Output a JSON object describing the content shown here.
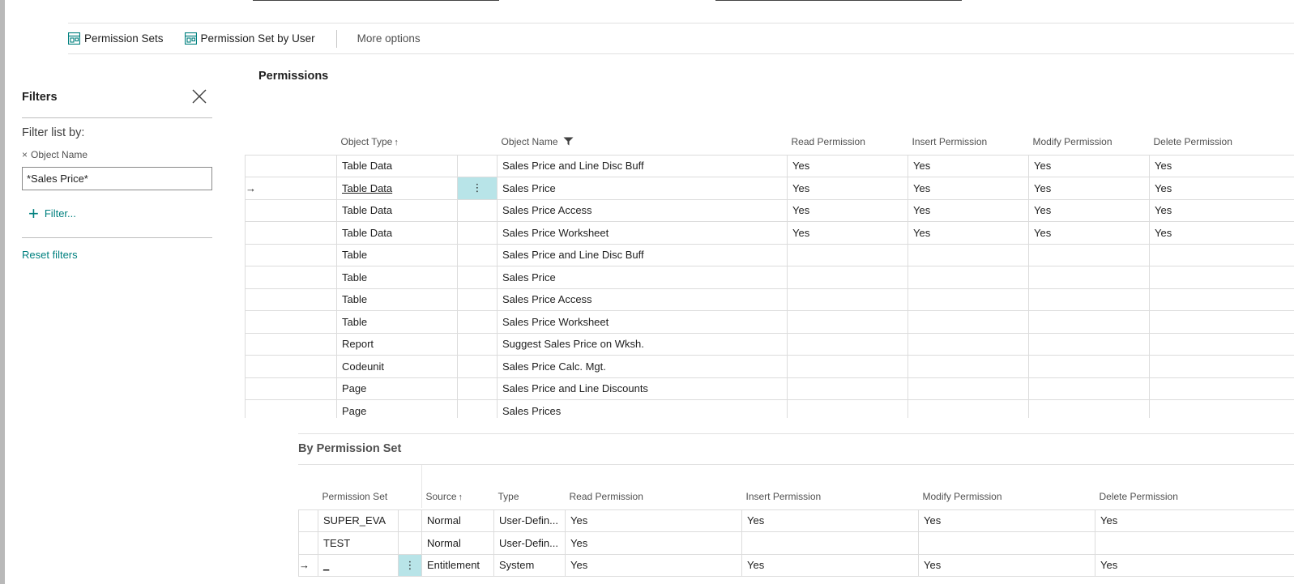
{
  "actions": {
    "permission_sets": "Permission Sets",
    "permission_set_by_user": "Permission Set by User",
    "more_options": "More options"
  },
  "filters": {
    "title": "Filters",
    "filter_list_by": "Filter list by:",
    "field_label": "Object Name",
    "field_value": "*Sales Price*",
    "add_filter": "Filter...",
    "reset": "Reset filters"
  },
  "permissions": {
    "title": "Permissions",
    "columns": {
      "object_type": "Object Type",
      "object_name": "Object Name",
      "read": "Read Permission",
      "insert": "Insert Permission",
      "modify": "Modify Permission",
      "delete": "Delete Permission"
    },
    "rows": [
      {
        "type": "Table Data",
        "name": "Sales Price and Line Disc Buff",
        "read": "Yes",
        "insert": "Yes",
        "modify": "Yes",
        "delete": "Yes"
      },
      {
        "type": "Table Data",
        "name": "Sales Price",
        "read": "Yes",
        "insert": "Yes",
        "modify": "Yes",
        "delete": "Yes"
      },
      {
        "type": "Table Data",
        "name": "Sales Price Access",
        "read": "Yes",
        "insert": "Yes",
        "modify": "Yes",
        "delete": "Yes"
      },
      {
        "type": "Table Data",
        "name": "Sales Price Worksheet",
        "read": "Yes",
        "insert": "Yes",
        "modify": "Yes",
        "delete": "Yes"
      },
      {
        "type": "Table",
        "name": "Sales Price and Line Disc Buff",
        "read": "",
        "insert": "",
        "modify": "",
        "delete": ""
      },
      {
        "type": "Table",
        "name": "Sales Price",
        "read": "",
        "insert": "",
        "modify": "",
        "delete": ""
      },
      {
        "type": "Table",
        "name": "Sales Price Access",
        "read": "",
        "insert": "",
        "modify": "",
        "delete": ""
      },
      {
        "type": "Table",
        "name": "Sales Price Worksheet",
        "read": "",
        "insert": "",
        "modify": "",
        "delete": ""
      },
      {
        "type": "Report",
        "name": "Suggest Sales Price on Wksh.",
        "read": "",
        "insert": "",
        "modify": "",
        "delete": ""
      },
      {
        "type": "Codeunit",
        "name": "Sales Price Calc. Mgt.",
        "read": "",
        "insert": "",
        "modify": "",
        "delete": ""
      },
      {
        "type": "Page",
        "name": "Sales Price and Line Discounts",
        "read": "",
        "insert": "",
        "modify": "",
        "delete": ""
      },
      {
        "type": "Page",
        "name": "Sales Prices",
        "read": "",
        "insert": "",
        "modify": "",
        "delete": ""
      }
    ]
  },
  "by_permission_set": {
    "title": "By Permission Set",
    "columns": {
      "permission_set": "Permission Set",
      "source": "Source",
      "type": "Type",
      "read": "Read Permission",
      "insert": "Insert Permission",
      "modify": "Modify Permission",
      "delete": "Delete Permission"
    },
    "rows": [
      {
        "set": "SUPER_EVA",
        "source": "Normal",
        "type": "User-Defin...",
        "read": "Yes",
        "insert": "Yes",
        "modify": "Yes",
        "delete": "Yes"
      },
      {
        "set": "TEST",
        "source": "Normal",
        "type": "User-Defin...",
        "read": "Yes",
        "insert": "",
        "modify": "",
        "delete": ""
      },
      {
        "set": "_",
        "source": "Entitlement",
        "type": "System",
        "read": "Yes",
        "insert": "Yes",
        "modify": "Yes",
        "delete": "Yes"
      }
    ]
  },
  "colors": {
    "accent": "#00807f",
    "selected_cell": "#b8e4e8"
  },
  "icons": {
    "sort_ascending": "↑",
    "filter": "filter-icon",
    "row_arrow": "→",
    "context_menu": "⋮",
    "remove": "×"
  }
}
